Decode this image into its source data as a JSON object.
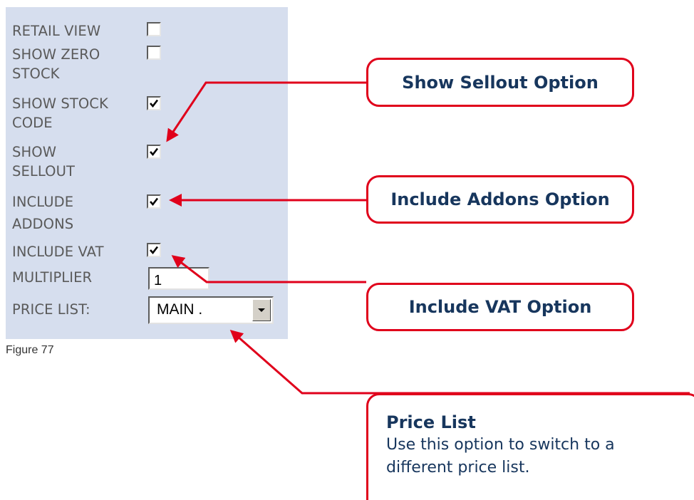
{
  "options": {
    "retail_view": {
      "label": "RETAIL VIEW",
      "checked": false
    },
    "show_zero_stock": {
      "label_line1": "SHOW ZERO",
      "label_line2": "STOCK",
      "checked": false
    },
    "show_stock_code": {
      "label_line1": "SHOW STOCK",
      "label_line2": "CODE",
      "checked": true
    },
    "show_sellout": {
      "label_line1": "SHOW",
      "label_line2": "SELLOUT",
      "checked": true
    },
    "include_addons": {
      "label_line1": "INCLUDE",
      "label_line2": "ADDONS",
      "checked": true
    },
    "include_vat": {
      "label": "INCLUDE VAT",
      "checked": true
    },
    "multiplier": {
      "label": "MULTIPLIER",
      "value": "1"
    },
    "price_list": {
      "label": "PRICE LIST:",
      "value": "MAIN ."
    }
  },
  "caption": "Figure 77",
  "callouts": {
    "sellout": "Show Sellout Option",
    "addons": "Include Addons Option",
    "vat": "Include VAT Option",
    "price_list_title": "Price List",
    "price_list_body_1": "Use this option to switch to a",
    "price_list_body_2": "different price list."
  },
  "colors": {
    "panel_bg": "#d6deee",
    "callout_border": "#e0001b",
    "callout_text": "#17365d",
    "arrow": "#e0001b"
  },
  "icons": {
    "checkmark": "check-icon",
    "dropdown": "chevron-down-icon"
  }
}
